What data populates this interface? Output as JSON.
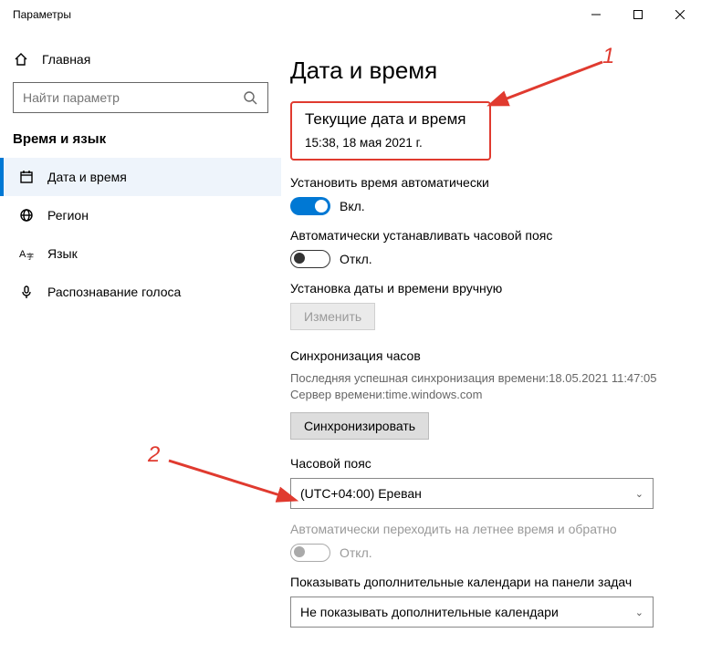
{
  "titlebar": {
    "title": "Параметры"
  },
  "sidebar": {
    "home": "Главная",
    "search_placeholder": "Найти параметр",
    "section": "Время и язык",
    "items": [
      {
        "label": "Дата и время"
      },
      {
        "label": "Регион"
      },
      {
        "label": "Язык"
      },
      {
        "label": "Распознавание голоса"
      }
    ]
  },
  "main": {
    "heading": "Дата и время",
    "current": {
      "title": "Текущие дата и время",
      "value": "15:38, 18 мая 2021 г."
    },
    "auto_time": {
      "label": "Установить время автоматически",
      "state": "Вкл."
    },
    "auto_tz": {
      "label": "Автоматически устанавливать часовой пояс",
      "state": "Откл."
    },
    "manual": {
      "label": "Установка даты и времени вручную",
      "button": "Изменить"
    },
    "sync": {
      "title": "Синхронизация часов",
      "line1": "Последняя успешная синхронизация времени:18.05.2021 11:47:05",
      "line2": "Сервер времени:time.windows.com",
      "button": "Синхронизировать"
    },
    "tz": {
      "title": "Часовой пояс",
      "value": "(UTC+04:00) Ереван"
    },
    "dst": {
      "label": "Автоматически переходить на летнее время и обратно",
      "state": "Откл."
    },
    "extra_cal": {
      "label": "Показывать дополнительные календари на панели задач",
      "value": "Не показывать дополнительные календари"
    }
  },
  "annotations": {
    "n1": "1",
    "n2": "2"
  }
}
